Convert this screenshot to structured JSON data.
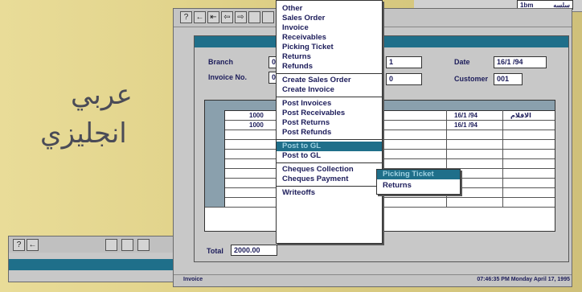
{
  "background_text": {
    "line1": "عربي",
    "line2": "انجليزي"
  },
  "top_right": {
    "label": "سلسه",
    "value": "1bm"
  },
  "toolbar": {
    "help": "?",
    "btn2": "←",
    "btn3": "⇤",
    "btn4": "⇦",
    "btn5": "⇨"
  },
  "form": {
    "branch_label": "Branch",
    "branch_value": "0",
    "invoice_label": "Invoice No.",
    "invoice_value": "0",
    "field3_value": "1",
    "field4_value": "0",
    "date_label": "Date",
    "date_value": "16/1 /94",
    "customer_label": "Customer",
    "customer_value": "001",
    "total_label": "Total",
    "total_value": "2000.00"
  },
  "grid": {
    "rows": [
      {
        "amount": "1000",
        "date": "16/1 /94",
        "name": "الاقلام"
      },
      {
        "amount": "1000",
        "date": "16/1 /94",
        "name": ""
      }
    ],
    "empty_rows": 8
  },
  "menu": {
    "items": [
      "Other",
      "Sales Order",
      "Invoice",
      "Receivables",
      "Picking Ticket",
      "Returns",
      "Refunds",
      "-",
      "Create Sales Order",
      "Create Invoice",
      "-",
      "Post Invoices",
      "Post Receivables",
      "Post Returns",
      "Post Refunds",
      "-",
      "Post to GL",
      "Post to GL",
      "-",
      "Cheques Collection",
      "Cheques Payment",
      "-",
      "Writeoffs"
    ],
    "highlighted": 16,
    "submenu": [
      "Picking Ticket",
      "Returns"
    ]
  },
  "statusbar": {
    "left": "Invoice",
    "right": "07:46:35 PM Monday April 17, 1995"
  },
  "colors": {
    "title_bar": "#1f6f8a",
    "grid_header": "#8aa0ad",
    "background": "#e2d48c"
  }
}
